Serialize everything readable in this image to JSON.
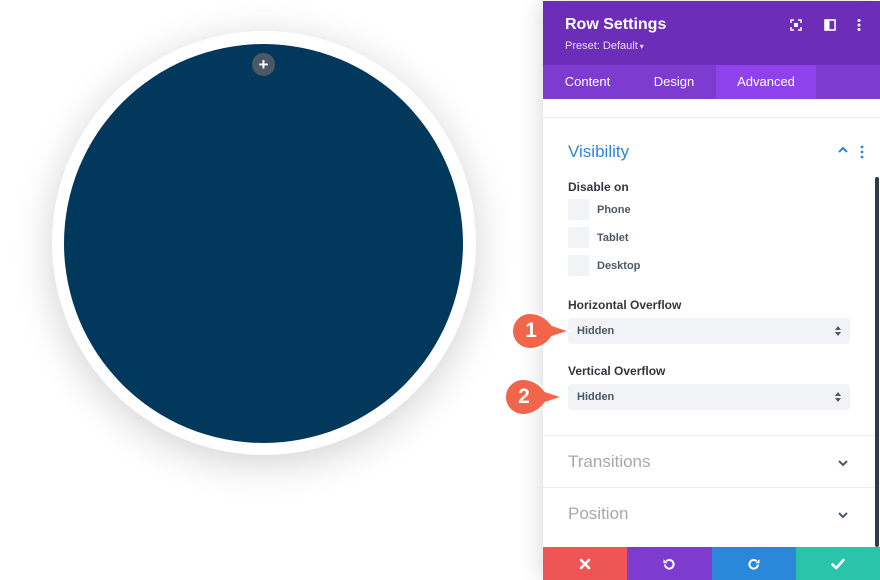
{
  "panel": {
    "title": "Row Settings",
    "preset_label": "Preset: Default",
    "preset_caret": "▾",
    "header_icons": [
      "expand-icon",
      "sidebar-toggle-icon",
      "more-options-icon"
    ]
  },
  "tabs": [
    {
      "label": "Content",
      "active": false
    },
    {
      "label": "Design",
      "active": false
    },
    {
      "label": "Advanced",
      "active": true
    }
  ],
  "visibility": {
    "title": "Visibility",
    "disable_on_label": "Disable on",
    "options": [
      {
        "label": "Phone",
        "checked": false
      },
      {
        "label": "Tablet",
        "checked": false
      },
      {
        "label": "Desktop",
        "checked": false
      }
    ],
    "horizontal_overflow": {
      "label": "Horizontal Overflow",
      "value": "Hidden"
    },
    "vertical_overflow": {
      "label": "Vertical Overflow",
      "value": "Hidden"
    }
  },
  "sections": [
    {
      "title": "Transitions"
    },
    {
      "title": "Position"
    }
  ],
  "annotations": [
    "1",
    "2"
  ],
  "add_button": "+",
  "colors": {
    "circle_fill": "#02385c",
    "panel_header": "#6c2eb9",
    "tabs_bar": "#7d3bcf",
    "tab_active": "#8f42ec",
    "accent_blue": "#2b87da",
    "close": "#ef5555",
    "undo": "#7e3bd0",
    "redo": "#2b87da",
    "save": "#29c4a9",
    "badge": "#f2654a"
  },
  "footer_buttons": [
    "close-icon",
    "undo-icon",
    "redo-icon",
    "save-check-icon"
  ]
}
